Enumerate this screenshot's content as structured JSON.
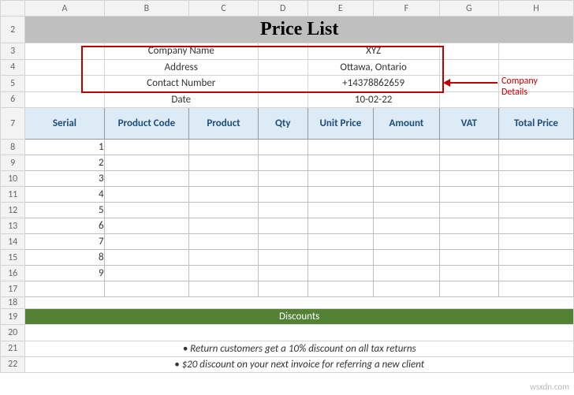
{
  "columns": [
    "A",
    "B",
    "C",
    "D",
    "E",
    "F",
    "G",
    "H"
  ],
  "rows": [
    "2",
    "3",
    "4",
    "5",
    "6",
    "7",
    "8",
    "9",
    "10",
    "11",
    "12",
    "13",
    "14",
    "15",
    "16",
    "17",
    "18",
    "19",
    "20",
    "21",
    "22"
  ],
  "title": "Price List",
  "company": {
    "name_label": "Company Name",
    "name": "XYZ",
    "addr_label": "Address",
    "addr": "Ottawa, Ontario",
    "contact_label": "Contact Number",
    "contact": "+14378862659",
    "date_label": "Date",
    "date": "10-02-22"
  },
  "headers": {
    "serial": "Serial",
    "code": "Product Code",
    "product": "Product",
    "qty": "Qty",
    "unit": "Unit Price",
    "amount": "Amount",
    "vat": "VAT",
    "total": "Total Price"
  },
  "serials": [
    "1",
    "2",
    "3",
    "4",
    "5",
    "6",
    "7",
    "8",
    "9"
  ],
  "discounts": {
    "header": "Discounts",
    "line1": "• Return customers get a 10% discount on all tax returns",
    "line2": "• $20 discount on your next invoice for referring a new client"
  },
  "callout": {
    "line1": "Company",
    "line2": "Details"
  },
  "watermark": "wsxdn.com"
}
